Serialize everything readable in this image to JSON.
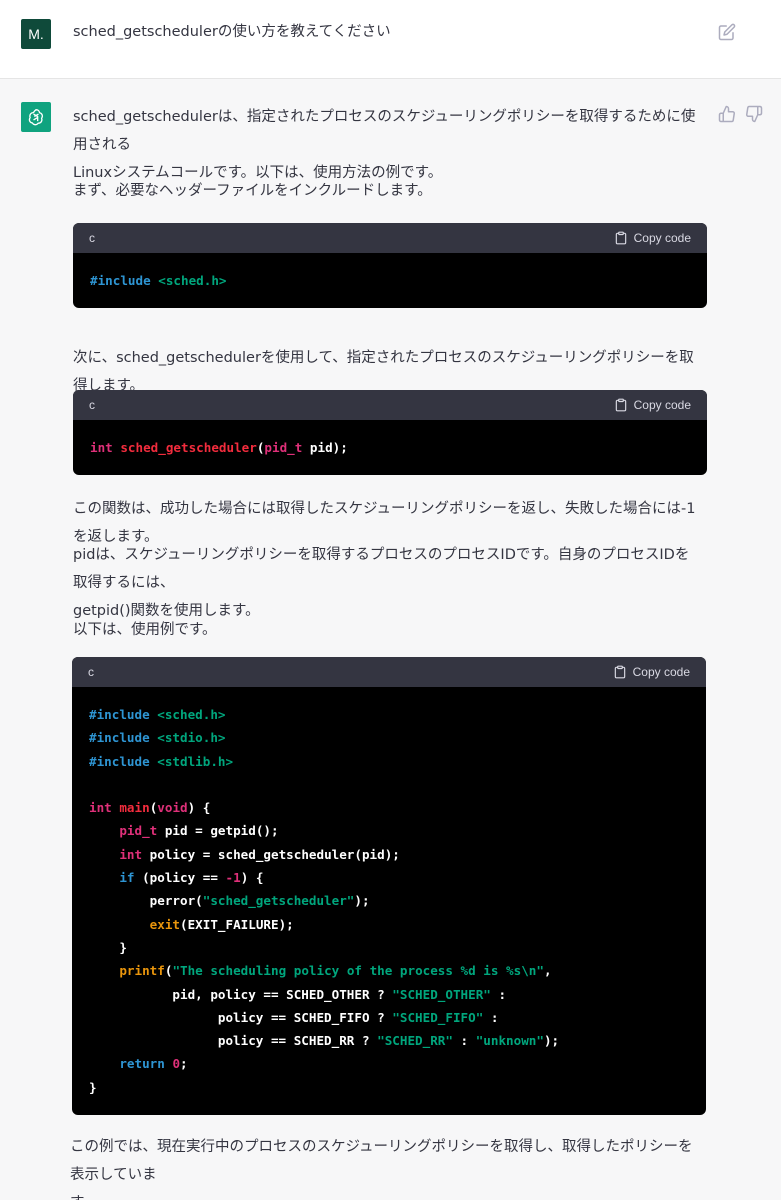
{
  "user": {
    "avatar_text": "M.",
    "message": "sched_getschedulerの使い方を教えてください"
  },
  "assistant": {
    "p1_line1": "sched_getschedulerは、指定されたプロセスのスケジューリングポリシーを取得するために使用される",
    "p1_line2": "Linuxシステムコールです。以下は、使用方法の例です。",
    "p2": "まず、必要なヘッダーファイルをインクルードします。",
    "code1": {
      "lang": "c",
      "copy_label": "Copy code",
      "lines": [
        [
          {
            "c": "kw-blue",
            "t": "#include "
          },
          {
            "c": "str",
            "t": "<sched.h>"
          }
        ]
      ]
    },
    "p3": "次に、sched_getschedulerを使用して、指定されたプロセスのスケジューリングポリシーを取得します。",
    "code2": {
      "lang": "c",
      "copy_label": "Copy code",
      "lines": [
        [
          {
            "c": "ty",
            "t": "int "
          },
          {
            "c": "fn",
            "t": "sched_getscheduler"
          },
          {
            "c": "",
            "t": "("
          },
          {
            "c": "ty",
            "t": "pid_t"
          },
          {
            "c": "",
            "t": " pid);"
          }
        ]
      ]
    },
    "p4": "この関数は、成功した場合には取得したスケジューリングポリシーを返し、失敗した場合には-1を返します。",
    "p5_line1": "pidは、スケジューリングポリシーを取得するプロセスのプロセスIDです。自身のプロセスIDを取得するには、",
    "p5_line2": "getpid()関数を使用します。",
    "p6": "以下は、使用例です。",
    "code3": {
      "lang": "c",
      "copy_label": "Copy code",
      "lines": [
        [
          {
            "c": "kw-blue",
            "t": "#include "
          },
          {
            "c": "str",
            "t": "<sched.h>"
          }
        ],
        [
          {
            "c": "kw-blue",
            "t": "#include "
          },
          {
            "c": "str",
            "t": "<stdio.h>"
          }
        ],
        [
          {
            "c": "kw-blue",
            "t": "#include "
          },
          {
            "c": "str",
            "t": "<stdlib.h>"
          }
        ],
        [
          {
            "c": "",
            "t": ""
          }
        ],
        [
          {
            "c": "ty",
            "t": "int "
          },
          {
            "c": "fn",
            "t": "main"
          },
          {
            "c": "",
            "t": "("
          },
          {
            "c": "ty",
            "t": "void"
          },
          {
            "c": "",
            "t": ") {"
          }
        ],
        [
          {
            "c": "",
            "t": "    "
          },
          {
            "c": "ty",
            "t": "pid_t"
          },
          {
            "c": "",
            "t": " pid = getpid();"
          }
        ],
        [
          {
            "c": "",
            "t": "    "
          },
          {
            "c": "ty",
            "t": "int"
          },
          {
            "c": "",
            "t": " policy = sched_getscheduler(pid);"
          }
        ],
        [
          {
            "c": "",
            "t": "    "
          },
          {
            "c": "kw-blue",
            "t": "if"
          },
          {
            "c": "",
            "t": " (policy == "
          },
          {
            "c": "num",
            "t": "-1"
          },
          {
            "c": "",
            "t": ") {"
          }
        ],
        [
          {
            "c": "",
            "t": "        perror("
          },
          {
            "c": "str",
            "t": "\"sched_getscheduler\""
          },
          {
            "c": "",
            "t": ");"
          }
        ],
        [
          {
            "c": "",
            "t": "        "
          },
          {
            "c": "orange",
            "t": "exit"
          },
          {
            "c": "",
            "t": "(EXIT_FAILURE);"
          }
        ],
        [
          {
            "c": "",
            "t": "    }"
          }
        ],
        [
          {
            "c": "",
            "t": "    "
          },
          {
            "c": "orange",
            "t": "printf"
          },
          {
            "c": "",
            "t": "("
          },
          {
            "c": "str",
            "t": "\"The scheduling policy of the process %d is %s\\n\""
          },
          {
            "c": "",
            "t": ","
          }
        ],
        [
          {
            "c": "",
            "t": "           pid, policy == SCHED_OTHER ? "
          },
          {
            "c": "str",
            "t": "\"SCHED_OTHER\""
          },
          {
            "c": "",
            "t": " :"
          }
        ],
        [
          {
            "c": "",
            "t": "                 policy == SCHED_FIFO ? "
          },
          {
            "c": "str",
            "t": "\"SCHED_FIFO\""
          },
          {
            "c": "",
            "t": " :"
          }
        ],
        [
          {
            "c": "",
            "t": "                 policy == SCHED_RR ? "
          },
          {
            "c": "str",
            "t": "\"SCHED_RR\""
          },
          {
            "c": "",
            "t": " : "
          },
          {
            "c": "str",
            "t": "\"unknown\""
          },
          {
            "c": "",
            "t": ");"
          }
        ],
        [
          {
            "c": "",
            "t": "    "
          },
          {
            "c": "kw-blue",
            "t": "return"
          },
          {
            "c": "",
            "t": " "
          },
          {
            "c": "num",
            "t": "0"
          },
          {
            "c": "",
            "t": ";"
          }
        ],
        [
          {
            "c": "",
            "t": "}"
          }
        ]
      ]
    },
    "p7_line1": "この例では、現在実行中のプロセスのスケジューリングポリシーを取得し、取得したポリシーを表示していま",
    "p7_line2": "す。"
  },
  "icons": {
    "edit": "edit-icon",
    "thumbs_up": "thumbs-up-icon",
    "thumbs_down": "thumbs-down-icon",
    "clipboard": "clipboard-icon",
    "assistant_logo": "openai-logo-icon"
  },
  "colors": {
    "user_avatar": "#0f4a3a",
    "assistant_avatar": "#10a37f",
    "code_header": "#343541",
    "code_body": "#000000"
  }
}
